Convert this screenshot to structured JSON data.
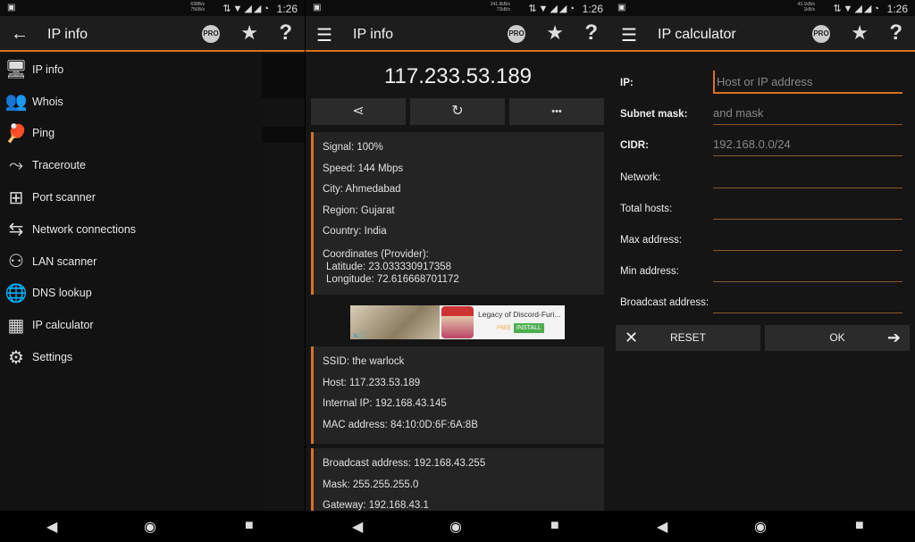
{
  "status_bars": [
    {
      "rate_up": "698B/s",
      "rate_down": "756B/s",
      "time": "1:26"
    },
    {
      "rate_up": "241.9kB/s",
      "rate_down": "71kB/s",
      "time": "1:26"
    },
    {
      "rate_up": "43.1kB/s",
      "rate_down": "1kB/s",
      "time": "1:26"
    }
  ],
  "header_icons": {
    "pro": "PRO",
    "star": "★",
    "help": "?"
  },
  "colors": {
    "accent": "#d9731e",
    "background": "#151515",
    "card": "#242424"
  },
  "drawer": {
    "title": "IP info",
    "items": [
      {
        "label": "IP info",
        "icon": "monitor-icon",
        "glyph": "🖥"
      },
      {
        "label": "Whois",
        "icon": "people-icon",
        "glyph": "👥"
      },
      {
        "label": "Ping",
        "icon": "ping-pong-icon",
        "glyph": "🏓"
      },
      {
        "label": "Traceroute",
        "icon": "route-icon",
        "glyph": "⤳"
      },
      {
        "label": "Port scanner",
        "icon": "network-icon",
        "glyph": "⊞"
      },
      {
        "label": "Network connections",
        "icon": "connections-icon",
        "glyph": "⇆"
      },
      {
        "label": "LAN scanner",
        "icon": "lan-icon",
        "glyph": "⚇"
      },
      {
        "label": "DNS lookup",
        "icon": "globe-icon",
        "glyph": "🌐"
      },
      {
        "label": "IP calculator",
        "icon": "calculator-icon",
        "glyph": "▦"
      },
      {
        "label": "Settings",
        "icon": "gear-icon",
        "glyph": "⚙"
      }
    ]
  },
  "ipinfo": {
    "title": "IP info",
    "ip": "117.233.53.189",
    "actions": [
      {
        "name": "share",
        "glyph": "⋖"
      },
      {
        "name": "refresh",
        "glyph": "↻"
      },
      {
        "name": "more",
        "glyph": "•••"
      }
    ],
    "card1": [
      "Signal: 100%",
      "Speed: 144 Mbps",
      "City: Ahmedabad",
      "Region: Gujarat",
      "Country: India"
    ],
    "coordinates": {
      "label": "Coordinates (Provider):",
      "latitude": "Latitude: 23.033330917358",
      "longitude": "Longitude: 72.616668701172"
    },
    "ad": {
      "title": "Legacy of Discord-Furi...",
      "free": "FREE",
      "install": "INSTALL"
    },
    "card2": [
      "SSID: the warlock",
      "Host: 117.233.53.189",
      "Internal IP: 192.168.43.145",
      "MAC address: 84:10:0D:6F:6A:8B"
    ],
    "card3": [
      "Broadcast address: 192.168.43.255",
      "Mask: 255.255.255.0",
      "Gateway: 192.168.43.1"
    ]
  },
  "calc": {
    "title": "IP calculator",
    "fields": [
      {
        "label": "IP:",
        "placeholder": "Host or IP address",
        "bold": true
      },
      {
        "label": "Subnet mask:",
        "placeholder": "and mask",
        "bold": true
      },
      {
        "label": "CIDR:",
        "placeholder": "192.168.0.0/24",
        "bold": true
      },
      {
        "label": "Network:",
        "placeholder": ""
      },
      {
        "label": "Total hosts:",
        "placeholder": ""
      },
      {
        "label": "Max address:",
        "placeholder": ""
      },
      {
        "label": "Min address:",
        "placeholder": ""
      },
      {
        "label": "Broadcast address:",
        "placeholder": ""
      }
    ],
    "reset": "RESET",
    "ok": "OK"
  }
}
